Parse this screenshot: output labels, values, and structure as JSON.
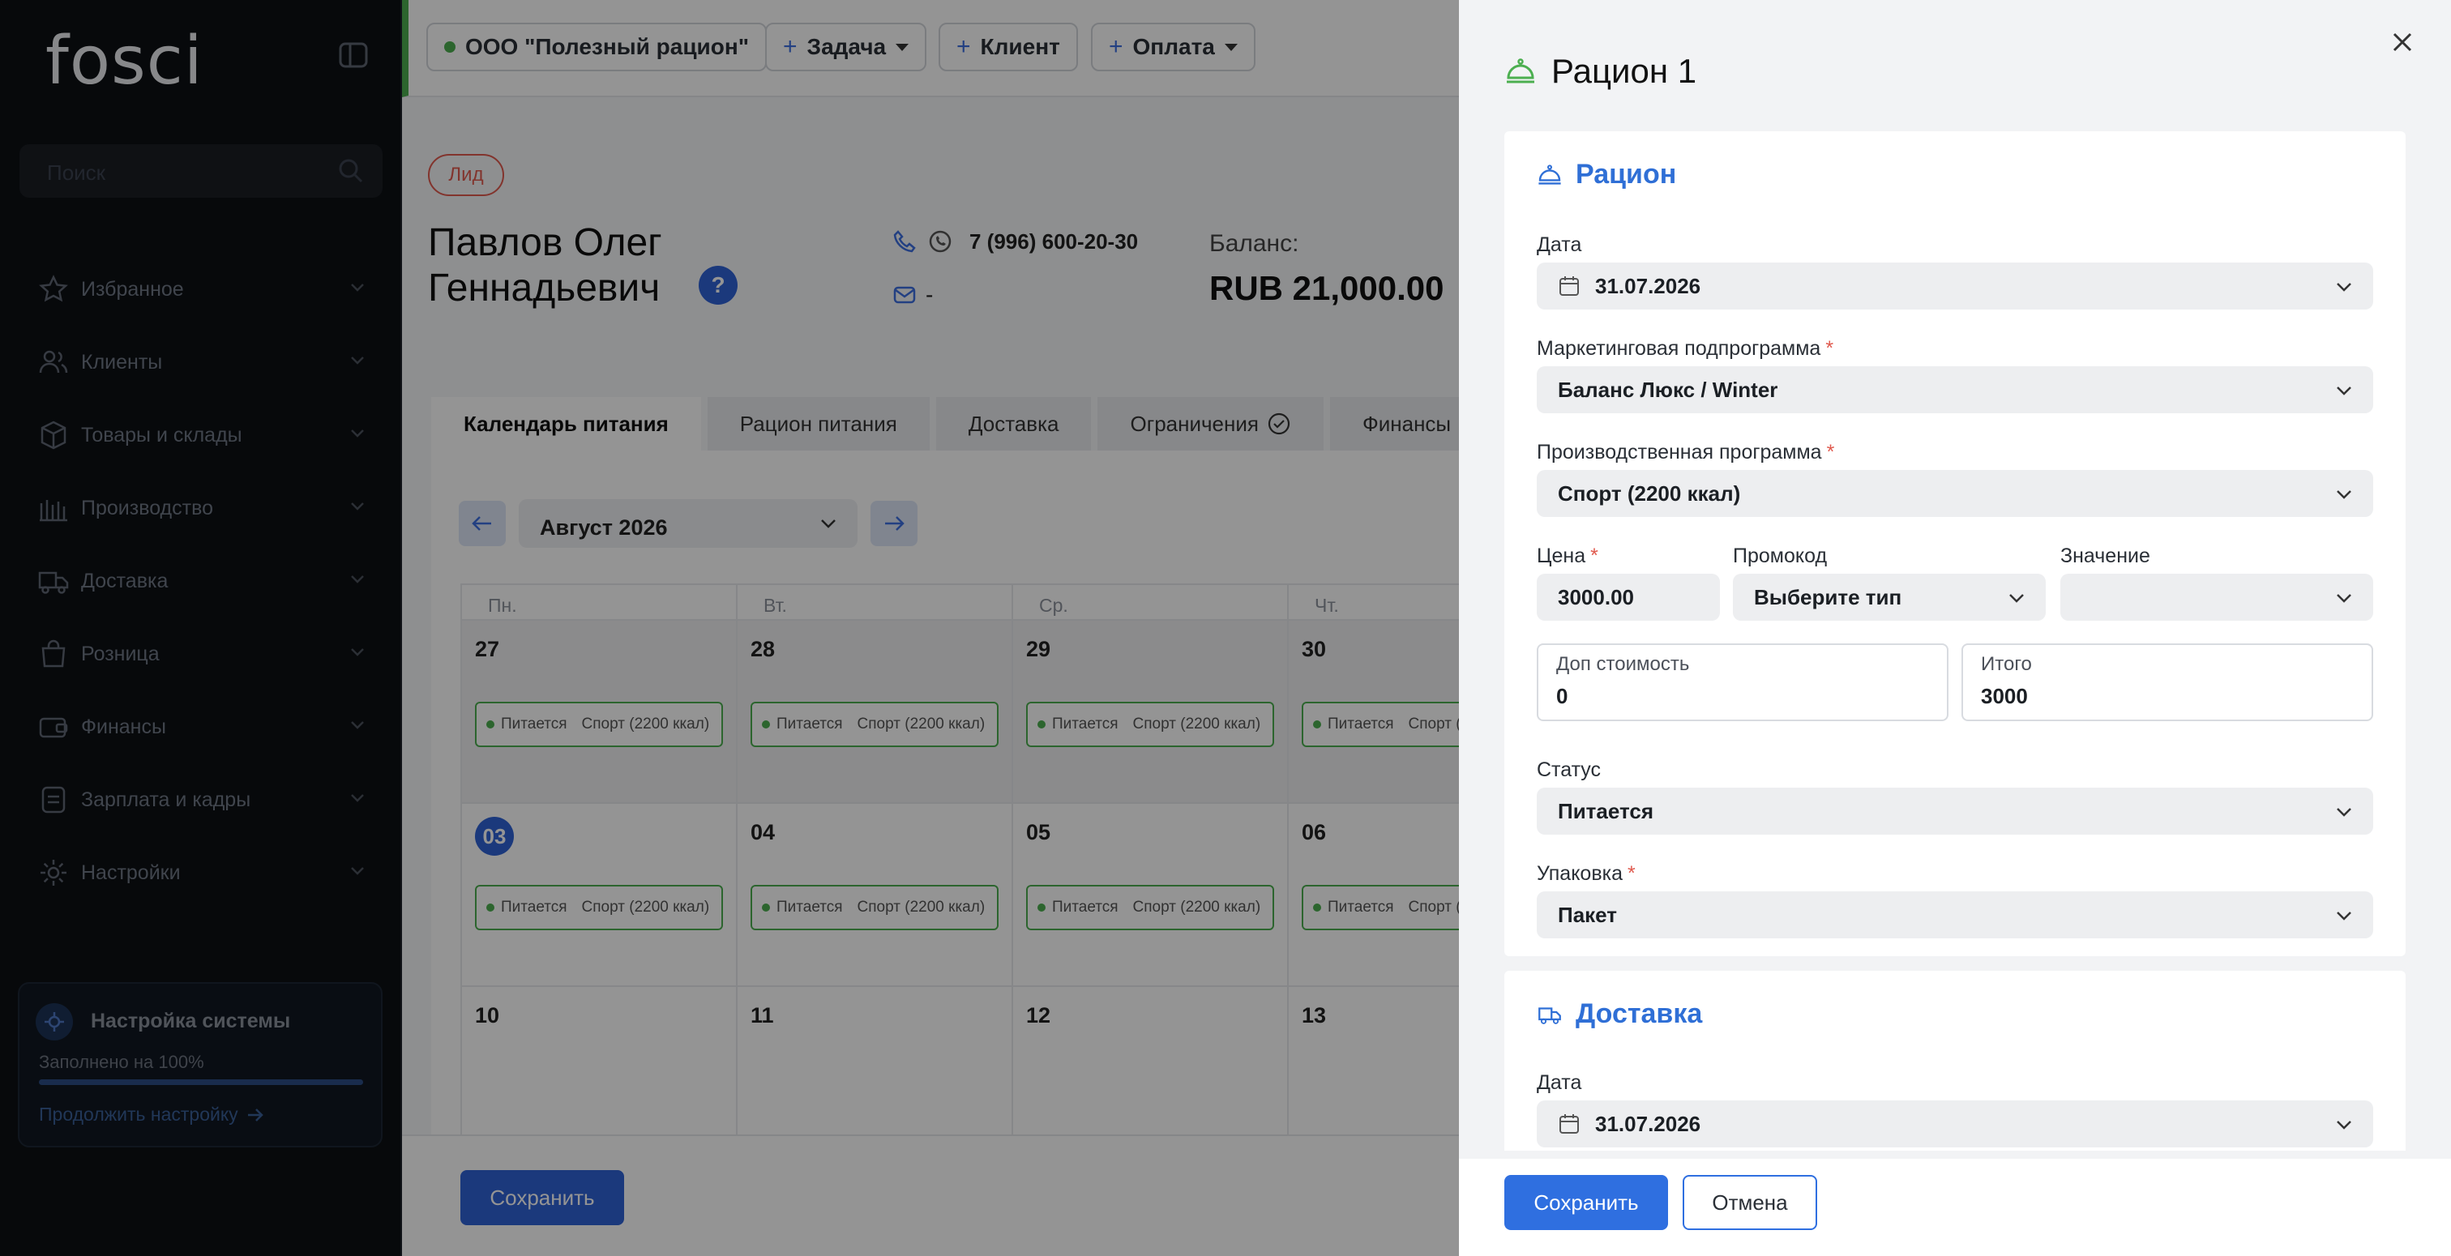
{
  "sidebar": {
    "logo": "fosci",
    "search_placeholder": "Поиск",
    "items": [
      {
        "label": "Избранное",
        "icon": "star-icon"
      },
      {
        "label": "Клиенты",
        "icon": "users-icon"
      },
      {
        "label": "Товары и склады",
        "icon": "box-icon"
      },
      {
        "label": "Производство",
        "icon": "factory-icon"
      },
      {
        "label": "Доставка",
        "icon": "truck-icon"
      },
      {
        "label": "Розница",
        "icon": "bag-icon"
      },
      {
        "label": "Финансы",
        "icon": "wallet-icon"
      },
      {
        "label": "Зарплата и кадры",
        "icon": "document-icon"
      },
      {
        "label": "Настройки",
        "icon": "gear-icon"
      }
    ],
    "setup": {
      "title": "Настройка системы",
      "progress_text": "Заполнено на 100%",
      "progress": 1.0,
      "continue_label": "Продолжить настройку"
    }
  },
  "topbar": {
    "company": "ООО \"Полезный рацион\"",
    "task": "Задача",
    "client": "Клиент",
    "payment": "Оплата"
  },
  "client": {
    "badge": "Лид",
    "name": "Павлов Олег Геннадьевич",
    "help": "?",
    "phone": "7 (996) 600-20-30",
    "email": "-",
    "balance_label": "Баланс:",
    "balance_value": "RUB 21,000.00"
  },
  "tabs": [
    {
      "label": "Календарь питания",
      "active": true
    },
    {
      "label": "Рацион питания"
    },
    {
      "label": "Доставка"
    },
    {
      "label": "Ограничения"
    },
    {
      "label": "Финансы"
    }
  ],
  "calendar": {
    "month": "Август 2026",
    "weekdays": [
      "Пн.",
      "Вт.",
      "Ср.",
      "Чт."
    ],
    "event_status": "Питается",
    "event_program": "Спорт (2200 ккал)",
    "weeks": [
      {
        "days": [
          "27",
          "28",
          "29",
          "30"
        ],
        "past": true,
        "events": true
      },
      {
        "days": [
          "03",
          "04",
          "05",
          "06"
        ],
        "past": false,
        "events": true,
        "today_index": 0
      },
      {
        "days": [
          "10",
          "11",
          "12",
          "13"
        ],
        "past": false,
        "events": false
      }
    ]
  },
  "main_footer": {
    "save_label": "Сохранить"
  },
  "drawer": {
    "title": "Рацион 1",
    "ration": {
      "section_title": "Рацион",
      "date_label": "Дата",
      "date_value": "31.07.2026",
      "marketing_label": "Маркетинговая подпрограмма",
      "marketing_value": "Баланс Люкс / Winter",
      "production_label": "Производственная программа",
      "production_value": "Спорт (2200 ккал)",
      "price_label": "Цена",
      "price_value": "3000.00",
      "promo_label": "Промокод",
      "promo_value": "Выберите тип",
      "value_label": "Значение",
      "value_value": "",
      "extra_label": "Доп стоимость",
      "extra_value": "0",
      "total_label": "Итого",
      "total_value": "3000",
      "status_label": "Статус",
      "status_value": "Питается",
      "package_label": "Упаковка",
      "package_value": "Пакет"
    },
    "delivery": {
      "section_title": "Доставка",
      "date_label": "Дата",
      "date_value": "31.07.2026"
    },
    "save_label": "Сохранить",
    "cancel_label": "Отмена"
  },
  "colors": {
    "accent": "#2f6fe0",
    "success": "#4caf50",
    "danger": "#e05a4e",
    "sidebar_bg": "#0d1014"
  }
}
